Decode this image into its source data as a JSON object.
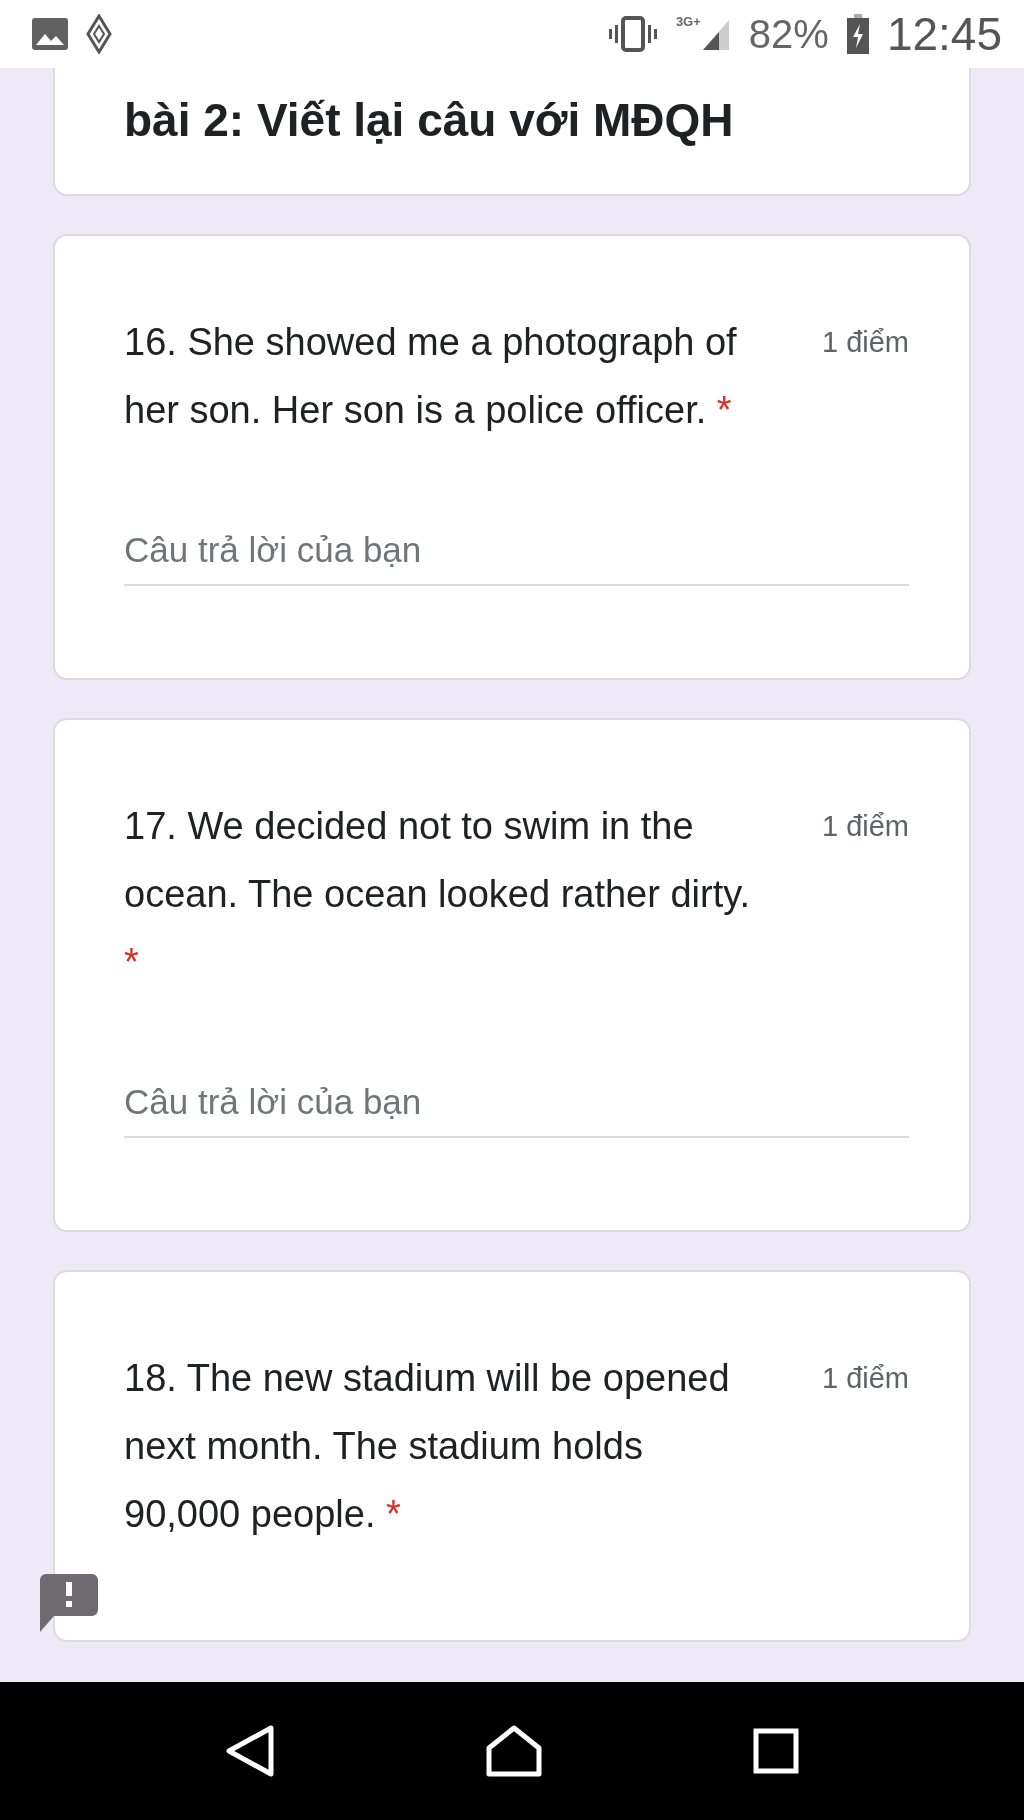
{
  "status_bar": {
    "network": "3G+",
    "battery": "82%",
    "time": "12:45"
  },
  "section": {
    "title": "bài 2: Viết lại câu với MĐQH"
  },
  "questions": [
    {
      "text": "16. She showed me a photograph of her son. Her son is a police officer.",
      "required_mark": "*",
      "points": "1 điểm",
      "placeholder": "Câu trả lời của bạn"
    },
    {
      "text": "17. We decided not to swim in the ocean. The ocean looked rather dirty.",
      "required_mark": "*",
      "points": "1 điểm",
      "placeholder": "Câu trả lời của bạn"
    },
    {
      "text": "18. The new stadium will be opened next month. The stadium holds 90,000 people.",
      "required_mark": "*",
      "points": "1 điểm"
    }
  ]
}
